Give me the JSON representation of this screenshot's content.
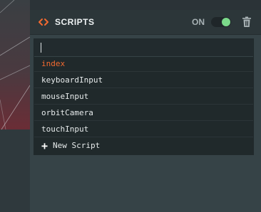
{
  "colors": {
    "accent": "#f26a30",
    "toggle_on": "#7bd98a",
    "panel_bg": "#364347",
    "header_bg": "#2c3639",
    "dropdown_bg": "#20292b"
  },
  "header": {
    "icon": "code-brackets-icon",
    "title": "SCRIPTS",
    "toggle_label": "ON",
    "toggle_state": "on",
    "delete_icon": "trash-icon"
  },
  "search": {
    "value": ""
  },
  "scripts": [
    {
      "label": "index",
      "selected": true
    },
    {
      "label": "keyboardInput",
      "selected": false
    },
    {
      "label": "mouseInput",
      "selected": false
    },
    {
      "label": "orbitCamera",
      "selected": false
    },
    {
      "label": "touchInput",
      "selected": false
    }
  ],
  "new_script": {
    "icon": "plus-icon",
    "label": "New Script"
  }
}
